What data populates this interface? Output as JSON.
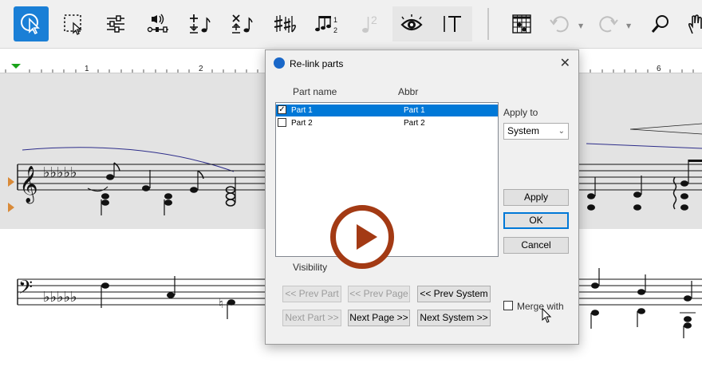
{
  "toolbar": {
    "buttons": [
      {
        "id": "select",
        "icon": "arrow-select-icon",
        "active": true
      },
      {
        "id": "marquee",
        "icon": "marquee-select-icon"
      },
      {
        "id": "settings",
        "icon": "sliders-icon"
      },
      {
        "id": "playback",
        "icon": "playback-icon"
      },
      {
        "id": "add-note",
        "icon": "add-note-icon"
      },
      {
        "id": "delete-note",
        "icon": "delete-note-icon"
      },
      {
        "id": "accidentals",
        "icon": "accidentals-icon"
      },
      {
        "id": "tuplet",
        "icon": "tuplet-icon"
      },
      {
        "id": "voice",
        "icon": "voice-icon"
      },
      {
        "id": "view",
        "icon": "eye-icon"
      },
      {
        "id": "text",
        "icon": "text-icon"
      },
      {
        "id": "chord",
        "icon": "chord-diagram-icon"
      },
      {
        "id": "undo",
        "icon": "undo-icon"
      },
      {
        "id": "redo",
        "icon": "redo-icon"
      },
      {
        "id": "zoom",
        "icon": "zoom-icon"
      },
      {
        "id": "hand",
        "icon": "hand-icon"
      }
    ]
  },
  "ruler": {
    "numbers": [
      "1",
      "2",
      "6"
    ]
  },
  "dialog": {
    "title": "Re-link parts",
    "close": "✕",
    "col_name": "Part name",
    "col_abbr": "Abbr",
    "parts": [
      {
        "name": "Part 1",
        "abbr": "Part 1",
        "checked": true,
        "selected": true
      },
      {
        "name": "Part 2",
        "abbr": "Part 2",
        "checked": false,
        "selected": false
      }
    ],
    "apply_to_label": "Apply to",
    "apply_to_value": "System",
    "apply": "Apply",
    "ok": "OK",
    "cancel": "Cancel",
    "visibility": "Visibility",
    "prev_part": "<< Prev Part",
    "prev_page": "<< Prev Page",
    "prev_system": "<< Prev System",
    "next_part": "Next Part >>",
    "next_page": "Next Page >>",
    "next_system": "Next System >>",
    "merge_with": "Merge with",
    "merge_checked": false
  },
  "colors": {
    "accent": "#1a7fd6",
    "play": "#a33a14",
    "selection": "#0078d7"
  }
}
